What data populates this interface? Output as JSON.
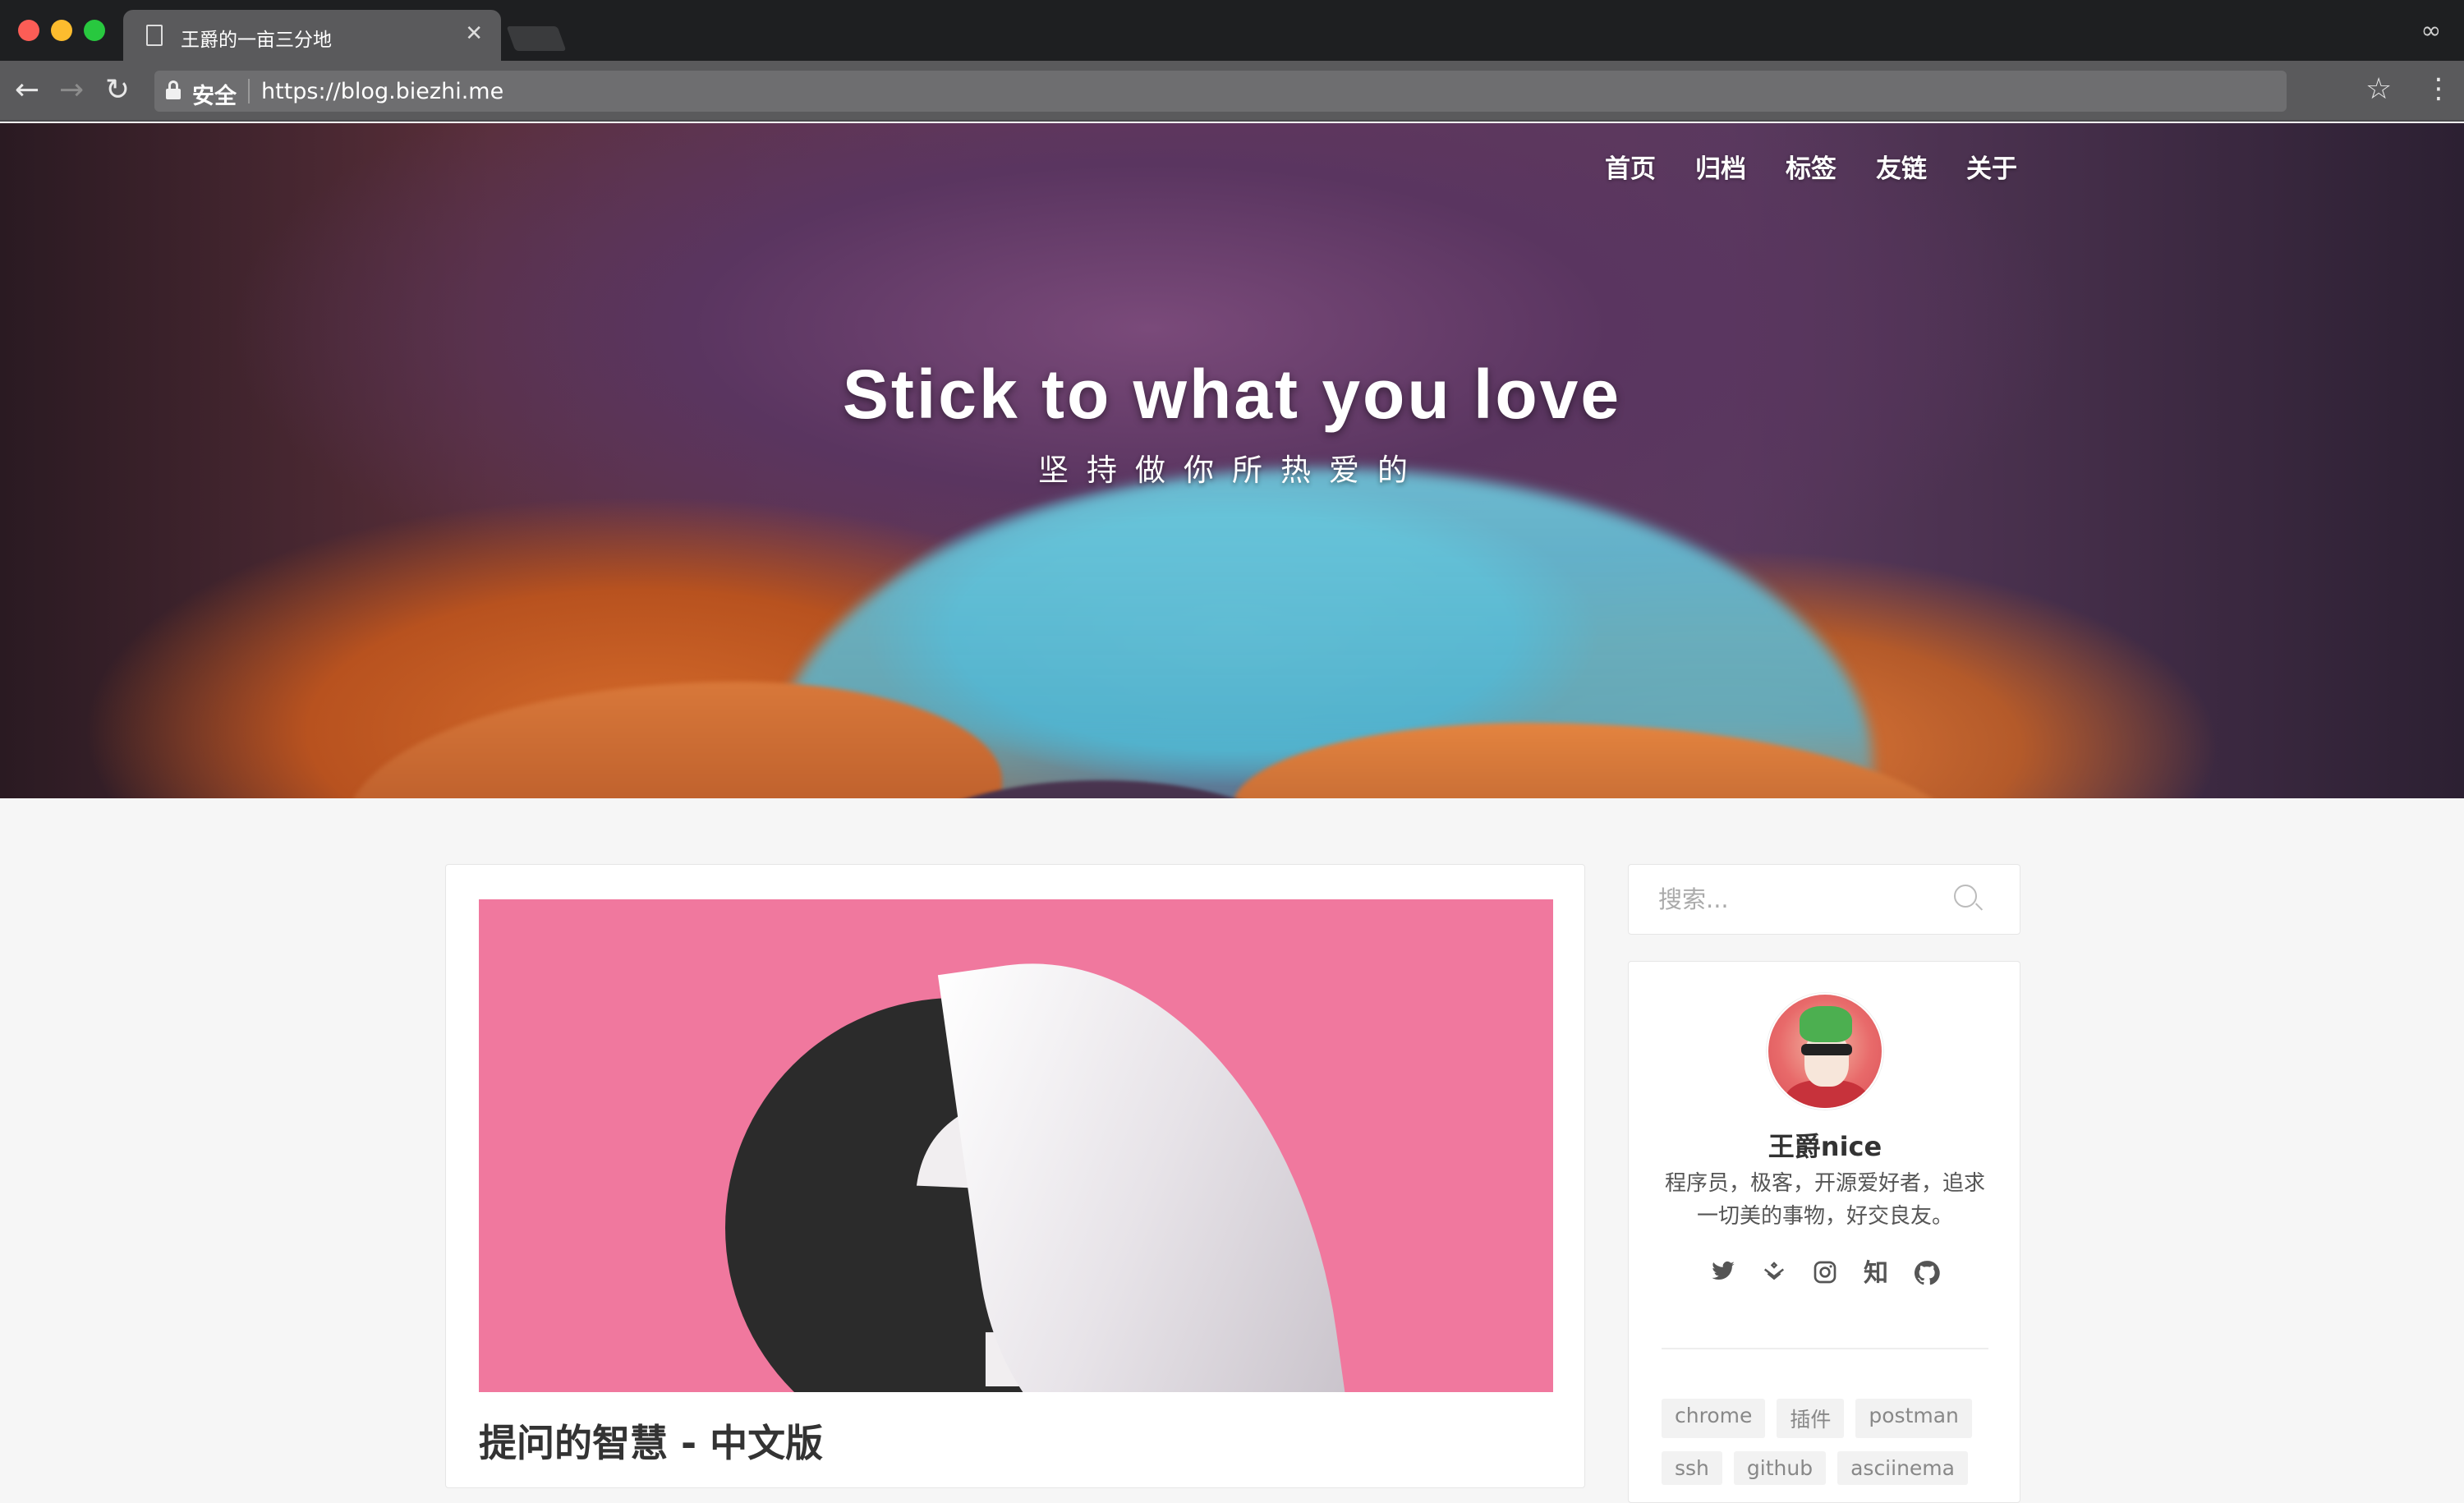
{
  "browser": {
    "tab_title": "王爵的一亩三分地",
    "secure_label": "安全",
    "url": "https://blog.biezhi.me"
  },
  "nav": {
    "items": [
      "首页",
      "归档",
      "标签",
      "友链",
      "关于"
    ]
  },
  "hero": {
    "title": "Stick to what you love",
    "subtitle": "坚持做你所热爱的"
  },
  "post": {
    "title": "提问的智慧 - 中文版"
  },
  "sidebar": {
    "search_placeholder": "搜索...",
    "profile": {
      "name": "王爵nice",
      "bio": "程序员，极客，开源爱好者，追求一切美的事物，好交良友。"
    },
    "social_icons": [
      "twitter-icon",
      "juejin-icon",
      "instagram-icon",
      "zhihu-icon",
      "github-icon"
    ],
    "zhihu_glyph": "知",
    "tags_row1": [
      "chrome",
      "插件",
      "postman"
    ],
    "tags_row2": [
      "ssh",
      "github",
      "asciinema"
    ]
  }
}
